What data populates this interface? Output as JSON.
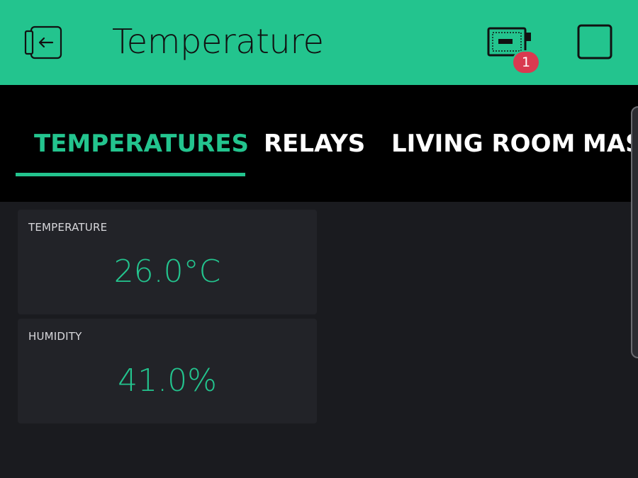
{
  "header": {
    "title": "Temperature",
    "back_icon": "exit-icon",
    "device_icon": "device-board-icon",
    "notification_count": "1",
    "square_icon": "square-icon",
    "bg_color": "#23c48e"
  },
  "tabs": [
    {
      "label": "TEMPERATURES",
      "active": true
    },
    {
      "label": "RELAYS",
      "active": false
    },
    {
      "label": "LIVING ROOM",
      "active": false
    },
    {
      "label": "MAST",
      "active": false
    }
  ],
  "widgets": [
    {
      "label": "TEMPERATURE",
      "value": "26.0°C"
    },
    {
      "label": "HUMIDITY",
      "value": "41.0%"
    }
  ],
  "colors": {
    "accent": "#23c48e",
    "badge": "#d93a50",
    "tab_bar": "#000000",
    "background": "#1a1b1f",
    "widget_bg": "#222328"
  }
}
